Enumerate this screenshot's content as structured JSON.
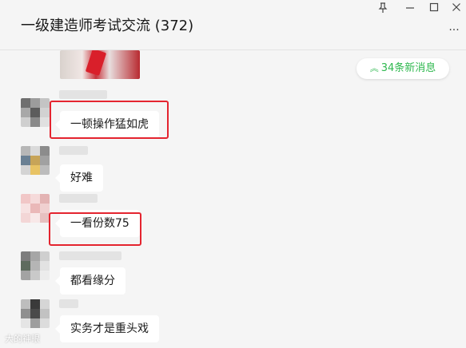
{
  "window": {
    "title": "一级建造师考试交流 (372)",
    "pin_icon": "pin-icon",
    "minimize_icon": "minimize-icon",
    "maximize_icon": "maximize-icon",
    "close_icon": "close-icon",
    "more_icon": "more-icon"
  },
  "new_messages": {
    "label": "34条新消息",
    "icon": "double-chevron-up-icon",
    "color": "#2fb84f"
  },
  "messages": [
    {
      "text": "一顿操作猛如虎",
      "highlighted": true
    },
    {
      "text": "好难",
      "highlighted": false
    },
    {
      "text": "一看份数75",
      "highlighted": true
    },
    {
      "text": "都看缘分",
      "highlighted": false
    },
    {
      "text": "实务才是重头戏",
      "highlighted": false
    }
  ],
  "highlight_color": "#e4242f",
  "watermark": "大的神眼"
}
